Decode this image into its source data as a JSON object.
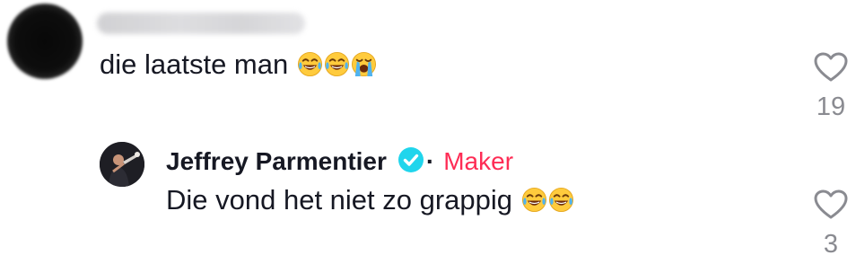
{
  "comment": {
    "username": "Stefanie Wiggers",
    "text": "die laatste man",
    "emojis": [
      "face-with-tears-of-joy",
      "face-with-tears-of-joy",
      "loudly-crying-face"
    ],
    "likes": "19"
  },
  "reply": {
    "username": "Jeffrey Parmentier",
    "separator": "·",
    "role_badge": "Maker",
    "text": "Die vond het niet zo grappig",
    "emojis": [
      "face-with-tears-of-joy",
      "face-with-tears-of-joy"
    ],
    "likes": "3"
  },
  "colors": {
    "text": "#161823",
    "muted": "#8a8b91",
    "maker": "#fe2c55",
    "verified": "#20d5ec"
  }
}
